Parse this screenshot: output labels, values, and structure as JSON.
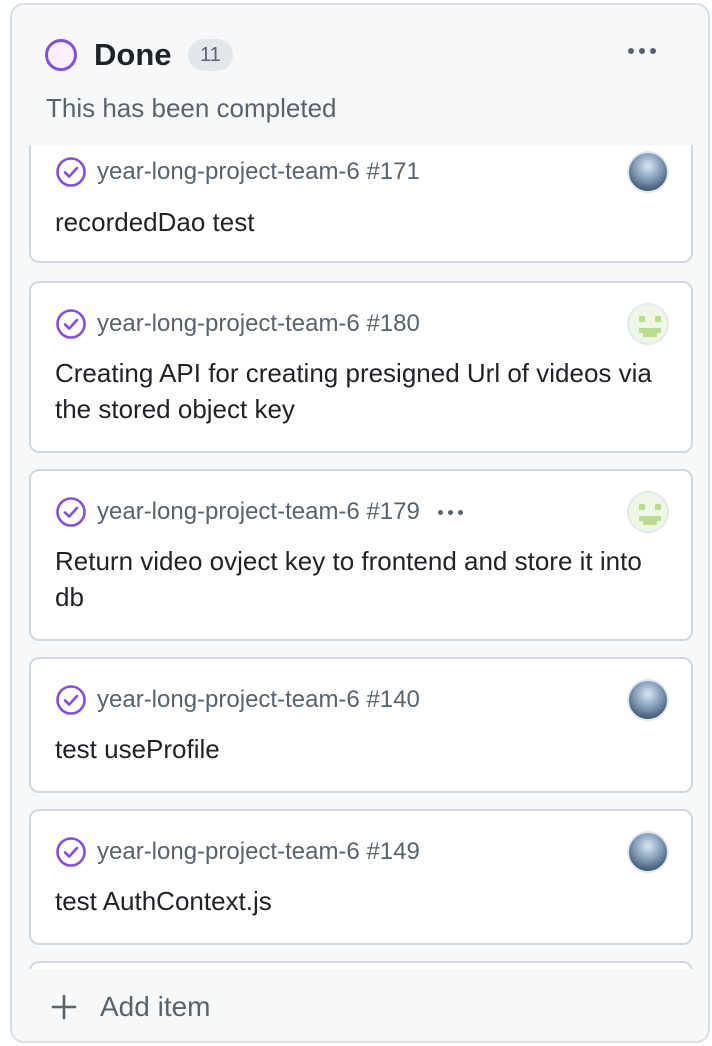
{
  "column": {
    "title": "Done",
    "count": "11",
    "description": "This has been completed",
    "status_color": "#8250df"
  },
  "cards": [
    {
      "repo": "year-long-project-team-6 #171",
      "title": "recordedDao test",
      "avatar": "photo-avatar",
      "has_menu": false
    },
    {
      "repo": "year-long-project-team-6 #180",
      "title": "Creating API for creating presigned Url of videos via the stored object key",
      "avatar": "identicon-avatar",
      "has_menu": false
    },
    {
      "repo": "year-long-project-team-6 #179",
      "title": "Return video ovject key to frontend and store it into db",
      "avatar": "identicon-avatar",
      "has_menu": true
    },
    {
      "repo": "year-long-project-team-6 #140",
      "title": "test useProfile",
      "avatar": "photo-avatar",
      "has_menu": false
    },
    {
      "repo": "year-long-project-team-6 #149",
      "title": "test AuthContext.js",
      "avatar": "photo-avatar",
      "has_menu": false
    }
  ],
  "footer": {
    "add_label": "Add item",
    "icon": "plus-icon"
  },
  "icons": {
    "status": "status-ring-icon",
    "done": "check-circle-icon",
    "menu": "kebab-menu-icon"
  }
}
